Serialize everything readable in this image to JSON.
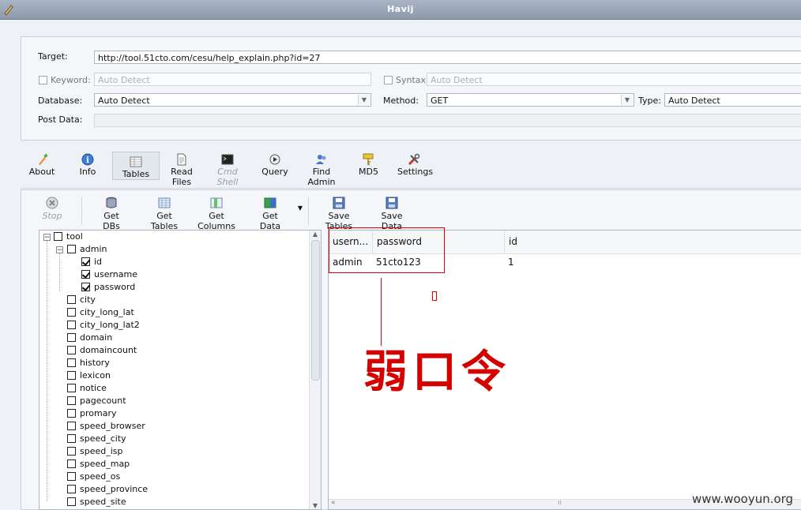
{
  "window": {
    "title": "Havij"
  },
  "form": {
    "target_label": "Target:",
    "target_value": "http://tool.51cto.com/cesu/help_explain.php?id=27",
    "keyword_label": "Keyword:",
    "keyword_placeholder": "Auto Detect",
    "syntax_label": "Syntax:",
    "syntax_placeholder": "Auto Detect",
    "database_label": "Database:",
    "database_value": "Auto Detect",
    "method_label": "Method:",
    "method_value": "GET",
    "type_label": "Type:",
    "type_value": "Auto Detect",
    "postdata_label": "Post Data:"
  },
  "main_toolbar": {
    "about": "About",
    "info": "Info",
    "tables": "Tables",
    "read_files": "Read Files",
    "cmd_shell": "Cmd Shell",
    "query": "Query",
    "find_admin": "Find Admin",
    "md5": "MD5",
    "settings": "Settings"
  },
  "sub_toolbar": {
    "stop": "Stop",
    "get_dbs": "Get DBs",
    "get_tables": "Get Tables",
    "get_columns": "Get Columns",
    "get_data": "Get Data",
    "save_tables": "Save Tables",
    "save_data": "Save Data"
  },
  "tree": {
    "root": "tool",
    "table_admin": "admin",
    "admin_columns": [
      "id",
      "username",
      "password"
    ],
    "tables": [
      "city",
      "city_long_lat",
      "city_long_lat2",
      "domain",
      "domaincount",
      "history",
      "lexicon",
      "notice",
      "pagecount",
      "promary",
      "speed_browser",
      "speed_city",
      "speed_isp",
      "speed_map",
      "speed_os",
      "speed_province",
      "speed_site"
    ]
  },
  "grid": {
    "columns": [
      "usern...",
      "password",
      "id"
    ],
    "rows": [
      [
        "admin",
        "51cto123",
        "1"
      ]
    ]
  },
  "annotation": {
    "text": "弱口令",
    "color": "#d40000"
  },
  "watermark": "www.wooyun.org"
}
